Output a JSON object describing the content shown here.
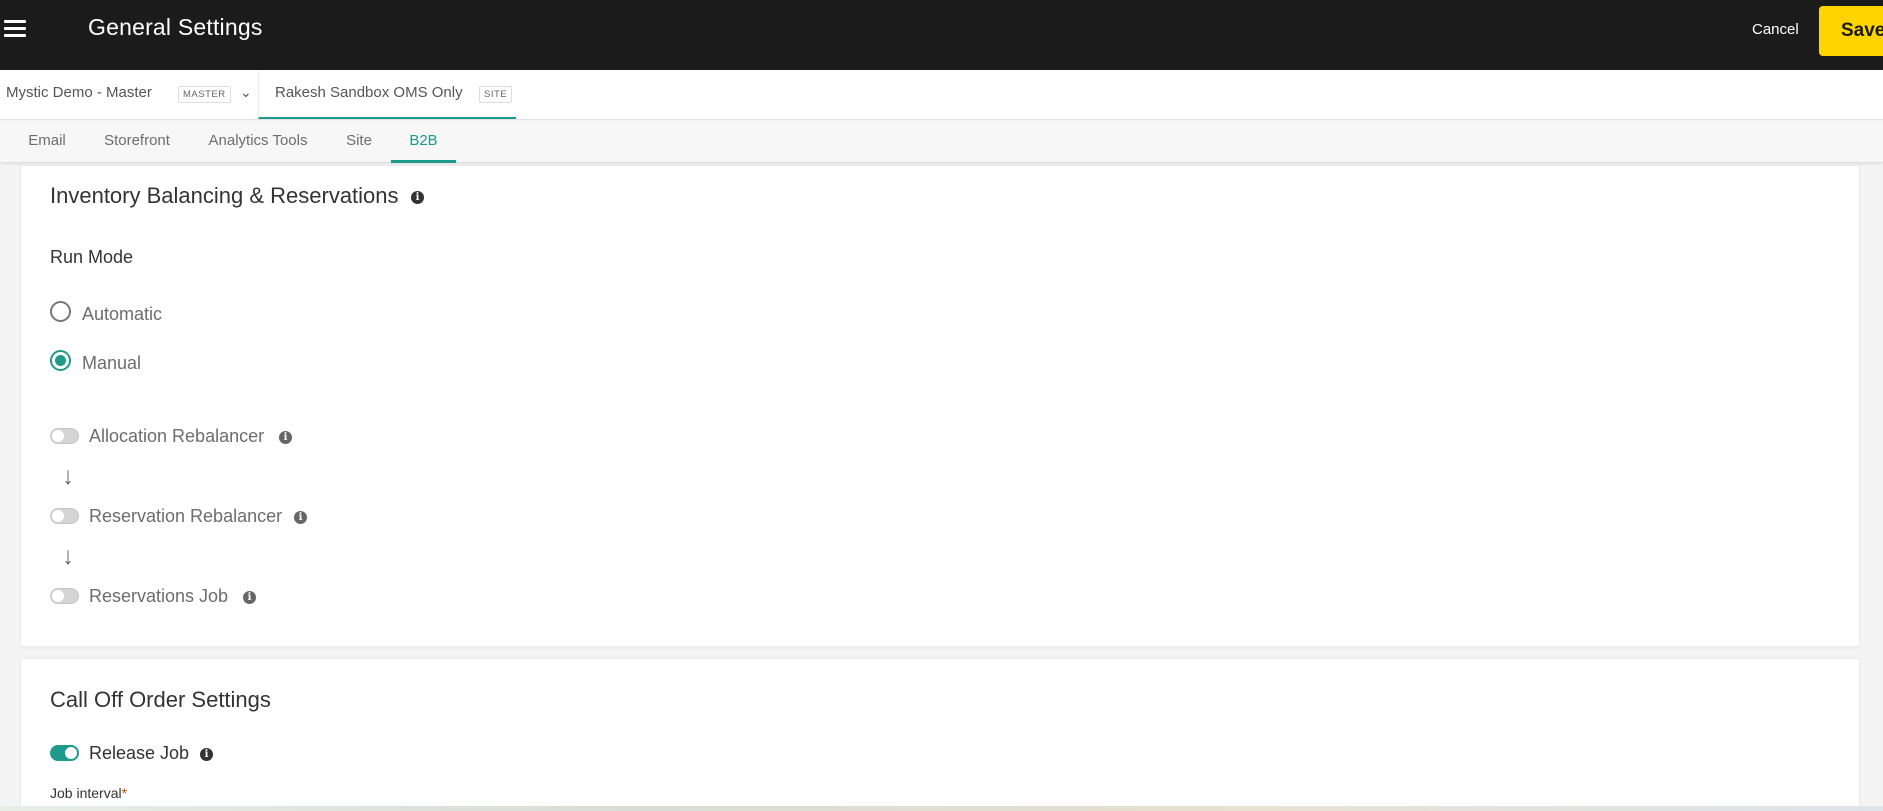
{
  "header": {
    "title": "General Settings",
    "cancel_label": "Cancel",
    "save_label": "Save"
  },
  "context": {
    "master": {
      "name": "Mystic Demo - Master",
      "badge": "MASTER"
    },
    "site": {
      "name": "Rakesh Sandbox OMS Only",
      "badge": "SITE"
    }
  },
  "tabs": [
    {
      "label": "Email"
    },
    {
      "label": "Storefront"
    },
    {
      "label": "Analytics Tools"
    },
    {
      "label": "Site"
    },
    {
      "label": "B2B",
      "active": true
    }
  ],
  "inventory": {
    "title": "Inventory Balancing & Reservations",
    "run_mode_label": "Run Mode",
    "run_mode_options": [
      {
        "label": "Automatic",
        "selected": false
      },
      {
        "label": "Manual",
        "selected": true
      }
    ],
    "jobs": [
      {
        "label": "Allocation Rebalancer",
        "enabled": false
      },
      {
        "label": "Reservation Rebalancer",
        "enabled": false
      },
      {
        "label": "Reservations Job",
        "enabled": false
      }
    ],
    "arrow_glyph": "↓"
  },
  "call_off": {
    "title": "Call Off Order Settings",
    "release_job_label": "Release Job",
    "release_job_enabled": true,
    "job_interval_label": "Job interval",
    "required_marker": "*"
  },
  "icons": {
    "menu": "hamburger-icon",
    "info": "info-icon",
    "chevron": "chevron-down-icon"
  },
  "colors": {
    "header_bg": "#1b1b1b",
    "accent": "#1d9a8a",
    "save_button": "#ffd400"
  }
}
